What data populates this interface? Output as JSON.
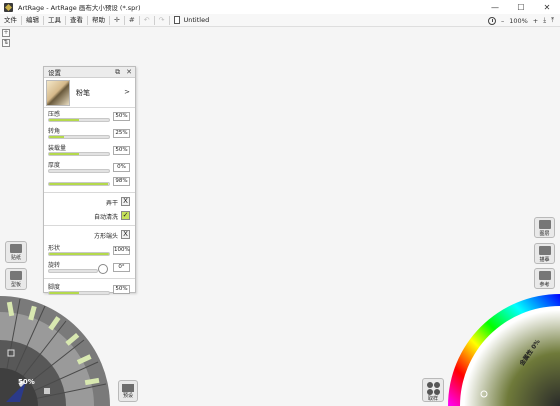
{
  "window": {
    "title": "ArtRage - ArtRage 画布大小预设 (*.spr)",
    "minimize": "—",
    "maximize": "☐",
    "close": "✕"
  },
  "menu": {
    "items": [
      "文件",
      "编辑",
      "工具",
      "查看",
      "帮助"
    ],
    "tool_glyphs": [
      "✛",
      "#",
      "↶",
      "↷"
    ],
    "document_title": "Untitled",
    "zoom_out": "–",
    "zoom_level": "100%",
    "zoom_in": "+",
    "import": "⤓",
    "export": "⤒"
  },
  "settings_panel": {
    "title": "设置",
    "tool_name": "粉笔",
    "tool_arrow": ">",
    "sliders": [
      {
        "label": "压感",
        "value": "50%",
        "fill": 0.5
      },
      {
        "label": "转角",
        "value": "25%",
        "fill": 0.25
      },
      {
        "label": "装载量",
        "value": "50%",
        "fill": 0.5
      },
      {
        "label": "厚度",
        "value": "0%",
        "fill": 0.0
      },
      {
        "label": "",
        "value": "98%",
        "fill": 0.98
      }
    ],
    "checks": [
      {
        "label": "弄干",
        "mark": "X",
        "on": false
      },
      {
        "label": "自动清洗",
        "mark": "✓",
        "on": true
      },
      {
        "label": "方形端头",
        "mark": "X",
        "on": false
      }
    ],
    "shape": {
      "label": "形状",
      "value": "100%",
      "fill": 1.0
    },
    "rotation": {
      "label": "旋转",
      "value": "0°"
    },
    "width": {
      "label": "脚度",
      "value": "50%",
      "fill": 0.5
    }
  },
  "left_buttons": {
    "stickers": "贴纸",
    "stencils": "型板"
  },
  "tool_wheel": {
    "zoom": "50%",
    "presets": "预设"
  },
  "right_buttons": {
    "layers": "图层",
    "canvas": "描摹",
    "reference": "参考"
  },
  "color_picker": {
    "swatches_label": "取样",
    "metallic_label": "金属性 0%"
  }
}
